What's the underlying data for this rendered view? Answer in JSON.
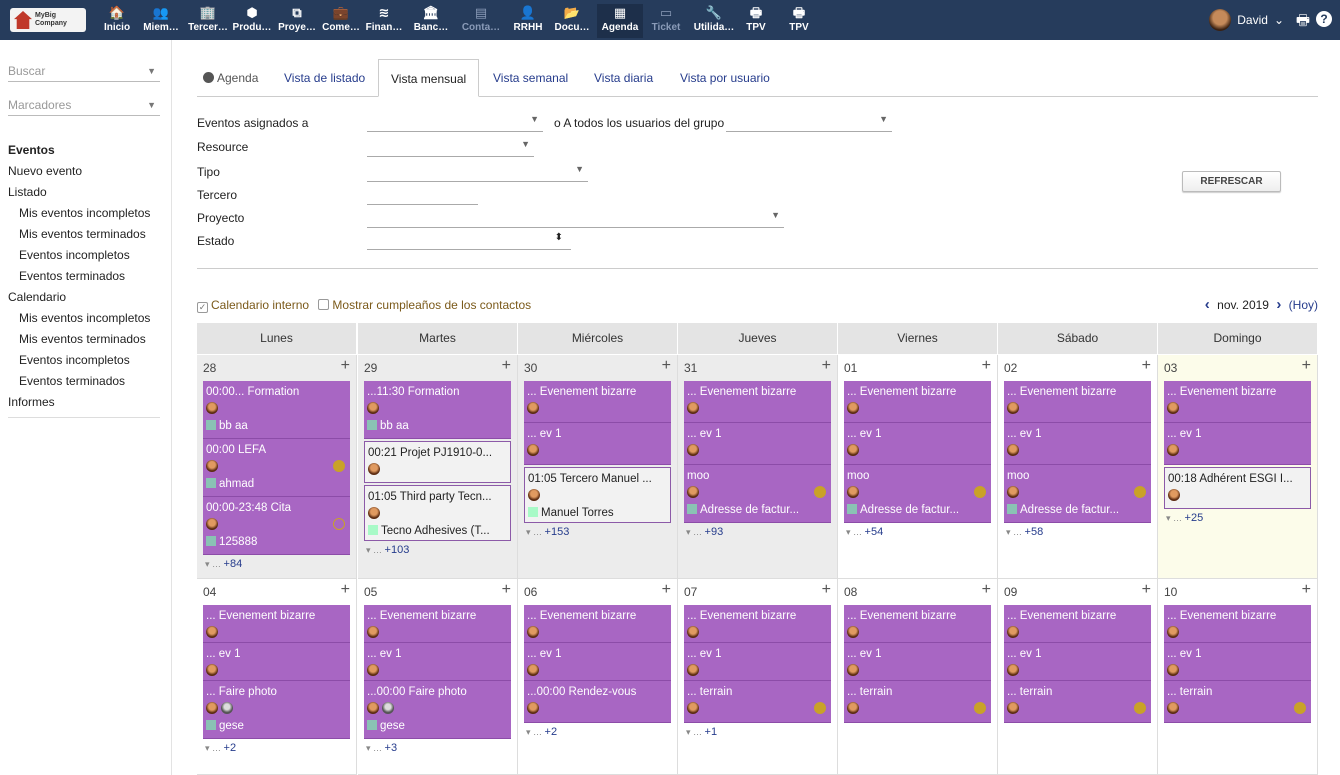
{
  "app": {
    "logo_line1": "MyBig",
    "logo_line2": "Company"
  },
  "topmenu": [
    {
      "label": "Inicio",
      "icon": "home-icon",
      "glyph": "🏠"
    },
    {
      "label": "Miem…",
      "icon": "members-icon",
      "glyph": "👥"
    },
    {
      "label": "Tercer…",
      "icon": "building-icon",
      "glyph": "🏢"
    },
    {
      "label": "Produ…",
      "icon": "cube-icon",
      "glyph": "⬢"
    },
    {
      "label": "Proye…",
      "icon": "sitemap-icon",
      "glyph": "⧉"
    },
    {
      "label": "Come…",
      "icon": "briefcase-icon",
      "glyph": "💼"
    },
    {
      "label": "Finan…",
      "icon": "coins-icon",
      "glyph": "≋"
    },
    {
      "label": "Banc…",
      "icon": "bank-icon",
      "glyph": "🏛"
    },
    {
      "label": "Conta…",
      "icon": "accounting-icon",
      "glyph": "▤"
    },
    {
      "label": "RRHH",
      "icon": "user-tie-icon",
      "glyph": "👤"
    },
    {
      "label": "Docu…",
      "icon": "folder-icon",
      "glyph": "📂"
    },
    {
      "label": "Agenda",
      "icon": "calendar-icon",
      "glyph": "▦"
    },
    {
      "label": "Ticket",
      "icon": "ticket-icon",
      "glyph": "▭"
    },
    {
      "label": "Utilida…",
      "icon": "wrench-icon",
      "glyph": "🔧"
    },
    {
      "label": "TPV",
      "icon": "cash-register-icon",
      "glyph": "🖶"
    },
    {
      "label": "TPV",
      "icon": "cash-register-icon",
      "glyph": "🖶"
    }
  ],
  "user": {
    "name": "David",
    "chevron": "⌄"
  },
  "toolbar_icons": {
    "print": "🖶",
    "help": "?"
  },
  "sidebar": {
    "search_placeholder": "Buscar",
    "bookmarks_placeholder": "Marcadores",
    "items": [
      {
        "label": "Eventos",
        "kind": "hd"
      },
      {
        "label": "Nuevo evento",
        "kind": "top"
      },
      {
        "label": "Listado",
        "kind": "top"
      },
      {
        "label": "Mis eventos incompletos",
        "kind": "ind"
      },
      {
        "label": "Mis eventos terminados",
        "kind": "ind"
      },
      {
        "label": "Eventos incompletos",
        "kind": "ind"
      },
      {
        "label": "Eventos terminados",
        "kind": "ind"
      },
      {
        "label": "Calendario",
        "kind": "top"
      },
      {
        "label": "Mis eventos incompletos",
        "kind": "ind"
      },
      {
        "label": "Mis eventos terminados",
        "kind": "ind"
      },
      {
        "label": "Eventos incompletos",
        "kind": "ind"
      },
      {
        "label": "Eventos terminados",
        "kind": "ind"
      },
      {
        "label": "Informes",
        "kind": "top"
      }
    ]
  },
  "tabs": {
    "agenda": "Agenda",
    "list": "Vista de listado",
    "month": "Vista mensual",
    "week": "Vista semanal",
    "day": "Vista diaria",
    "per_user": "Vista por usuario"
  },
  "filters": {
    "assigned": "Eventos asignados a",
    "all_users": "o A todos los usuarios del grupo",
    "resource": "Resource",
    "type": "Tipo",
    "thirdparty": "Tercero",
    "project": "Proyecto",
    "status": "Estado",
    "refresh": "REFRESCAR"
  },
  "checks": {
    "internal": "Calendario interno",
    "birthdays": "Mostrar cumpleaños de los contactos"
  },
  "nav": {
    "prev": "‹",
    "month": "nov. 2019",
    "next": "›",
    "today": "(Hoy)"
  },
  "weekdays": [
    "Lunes",
    "Martes",
    "Miércoles",
    "Jueves",
    "Viernes",
    "Sábado",
    "Domingo"
  ],
  "weeks": [
    [
      {
        "day": "28",
        "shade": "grey",
        "more": "+84",
        "events": [
          {
            "title": "00:00... Formation",
            "sub": "bb aa",
            "h": 58
          },
          {
            "title": "00:00 LEFA",
            "sub": "ahmad",
            "dot": "full",
            "h": 58
          },
          {
            "title": "00:00-23:48 Cita",
            "sub": "125888",
            "dot": "ring",
            "h": 58
          }
        ]
      },
      {
        "day": "29",
        "shade": "grey",
        "more": "+103",
        "events": [
          {
            "title": "...11:30 Formation",
            "sub": "bb aa",
            "h": 58
          },
          {
            "title": "00:21 Projet PJ1910-0...",
            "white": true,
            "h": 44
          },
          {
            "title": "01:05 Third party Tecn...",
            "sub": "Tecno Adhesives (T...",
            "white": true,
            "h": 58
          }
        ]
      },
      {
        "day": "30",
        "shade": "grey",
        "more": "+153",
        "events": [
          {
            "title": "... Evenement bizarre",
            "h": 42
          },
          {
            "title": "... ev 1",
            "h": 42
          },
          {
            "title": "01:05 Tercero Manuel ...",
            "sub": "Manuel Torres",
            "white": true,
            "h": 58
          }
        ]
      },
      {
        "day": "31",
        "shade": "grey",
        "more": "+93",
        "events": [
          {
            "title": "... Evenement bizarre",
            "h": 42
          },
          {
            "title": "... ev 1",
            "h": 42
          },
          {
            "title": "moo",
            "sub": "Adresse de factur...",
            "dot": "full",
            "h": 58
          }
        ]
      },
      {
        "day": "01",
        "more": "+54",
        "events": [
          {
            "title": "... Evenement bizarre",
            "h": 42
          },
          {
            "title": "... ev 1",
            "h": 42
          },
          {
            "title": "moo",
            "sub": "Adresse de factur...",
            "dot": "full",
            "h": 58
          }
        ]
      },
      {
        "day": "02",
        "more": "+58",
        "events": [
          {
            "title": "... Evenement bizarre",
            "h": 42
          },
          {
            "title": "... ev 1",
            "h": 42
          },
          {
            "title": "moo",
            "sub": "Adresse de factur...",
            "dot": "full",
            "h": 58
          }
        ]
      },
      {
        "day": "03",
        "shade": "today",
        "more": "+25",
        "events": [
          {
            "title": "... Evenement bizarre",
            "h": 42
          },
          {
            "title": "... ev 1",
            "h": 42
          },
          {
            "title": "00:18 Adhérent ESGI I...",
            "white": true,
            "h": 44
          }
        ]
      }
    ],
    [
      {
        "day": "04",
        "more": "+2",
        "events": [
          {
            "title": "... Evenement bizarre",
            "h": 38
          },
          {
            "title": "... ev 1",
            "h": 38
          },
          {
            "title": "... Faire photo",
            "sub": "gese",
            "two": true,
            "h": 58
          }
        ]
      },
      {
        "day": "05",
        "more": "+3",
        "events": [
          {
            "title": "... Evenement bizarre",
            "h": 38
          },
          {
            "title": "... ev 1",
            "h": 38
          },
          {
            "title": "...00:00 Faire photo",
            "sub": "gese",
            "two": true,
            "h": 58
          }
        ]
      },
      {
        "day": "06",
        "more": "+2",
        "events": [
          {
            "title": "... Evenement bizarre",
            "h": 38
          },
          {
            "title": "... ev 1",
            "h": 38
          },
          {
            "title": "...00:00 Rendez-vous",
            "h": 42
          }
        ]
      },
      {
        "day": "07",
        "more": "+1",
        "events": [
          {
            "title": "... Evenement bizarre",
            "h": 38
          },
          {
            "title": "... ev 1",
            "h": 38
          },
          {
            "title": "... terrain",
            "dot": "full",
            "h": 42
          }
        ]
      },
      {
        "day": "08",
        "events": [
          {
            "title": "... Evenement bizarre",
            "h": 38
          },
          {
            "title": "... ev 1",
            "h": 38
          },
          {
            "title": "... terrain",
            "dot": "full",
            "h": 42
          }
        ]
      },
      {
        "day": "09",
        "events": [
          {
            "title": "... Evenement bizarre",
            "h": 38
          },
          {
            "title": "... ev 1",
            "h": 38
          },
          {
            "title": "... terrain",
            "dot": "full",
            "h": 42
          }
        ]
      },
      {
        "day": "10",
        "events": [
          {
            "title": "... Evenement bizarre",
            "h": 38
          },
          {
            "title": "... ev 1",
            "h": 38
          },
          {
            "title": "... terrain",
            "dot": "full",
            "h": 42
          }
        ]
      }
    ]
  ]
}
